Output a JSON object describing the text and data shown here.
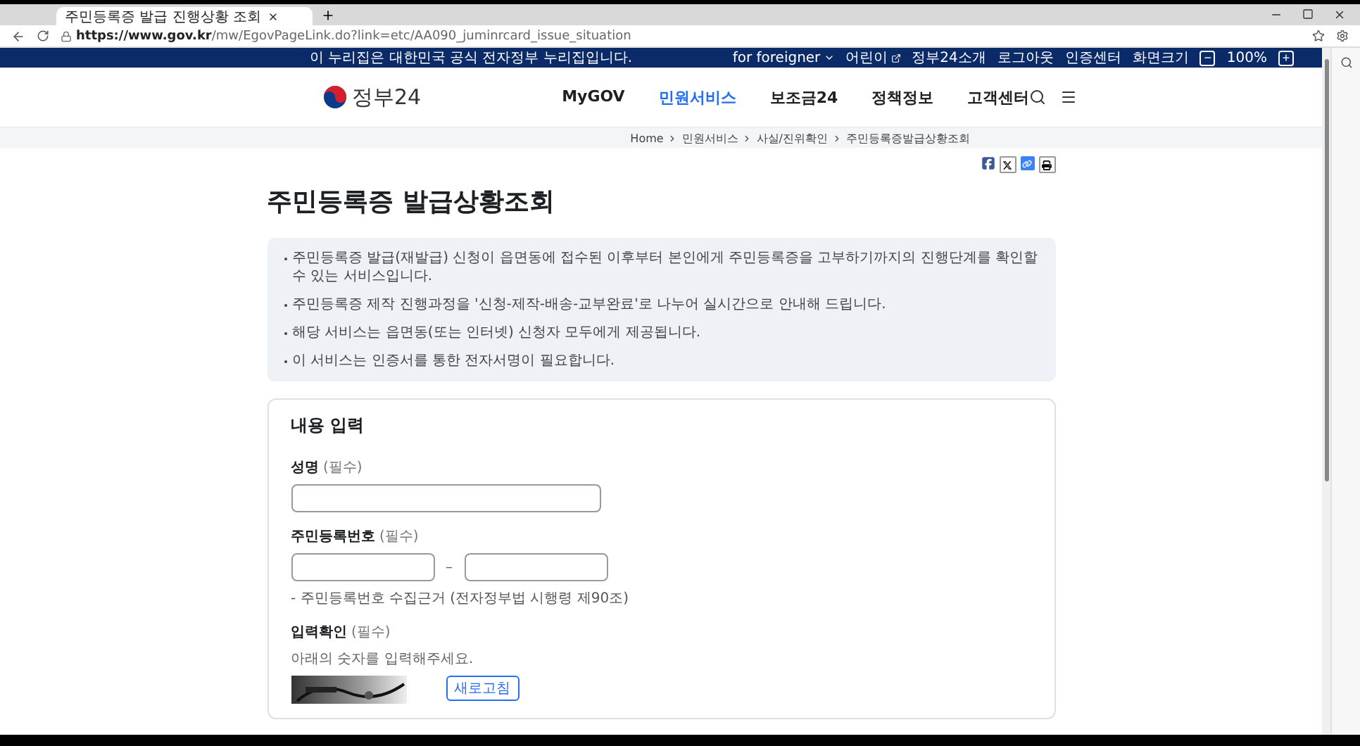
{
  "browser": {
    "tab_title": "주민등록증 발급 진행상황 조회",
    "url_host": "https://www.gov.kr",
    "url_path": "/mw/EgovPageLink.do?link=etc/AA090_juminrcard_issue_situation"
  },
  "gov_banner": {
    "text": "이 누리집은 대한민국 공식 전자정부 누리집입니다."
  },
  "utility_links": [
    {
      "label": "for foreigner",
      "kind": "dropdown"
    },
    {
      "label": "어린이",
      "kind": "external"
    },
    {
      "label": "정부24소개",
      "kind": "link"
    },
    {
      "label": "로그아웃",
      "kind": "link"
    },
    {
      "label": "인증센터",
      "kind": "link"
    }
  ],
  "zoom": {
    "label": "화면크기",
    "minus": "−",
    "value": "100%",
    "plus": "+"
  },
  "header": {
    "logo": "정부24",
    "nav": [
      {
        "label": "MyGOV",
        "selected": false
      },
      {
        "label": "민원서비스",
        "selected": true
      },
      {
        "label": "보조금24",
        "selected": false
      },
      {
        "label": "정책정보",
        "selected": false
      },
      {
        "label": "고객센터",
        "selected": false
      }
    ]
  },
  "breadcrumb": [
    "Home",
    "민원서비스",
    "사실/진위확인",
    "주민등록증발급상황조회"
  ],
  "page_title": "주민등록증 발급상황조회",
  "notices": [
    "주민등록증 발급(재발급) 신청이 읍면동에 접수된 이후부터 본인에게 주민등록증을 고부하기까지의 진행단계를 확인할 수 있는 서비스입니다.",
    "주민등록증 제작 진행과정을 '신청-제작-배송-교부완료'로 나누어 실시간으로 안내해 드립니다.",
    "해당 서비스는 읍면동(또는 인터넷) 신청자 모두에게 제공됩니다.",
    "이 서비스는 인증서를 통한 전자서명이 필요합니다."
  ],
  "form": {
    "heading": "내용 입력",
    "fields": [
      {
        "kind": "text",
        "label": "성명",
        "required": "(필수)"
      },
      {
        "kind": "rrn",
        "label": "주민등록번호",
        "required": "(필수)",
        "separator": "–",
        "note": "- 주민등록번호 수집근거 (전자정부법 시행령 제90조)"
      },
      {
        "kind": "captcha",
        "label": "입력확인",
        "required": "(필수)",
        "hint": "아래의 숫자를 입력해주세요.",
        "button": "새로고침"
      }
    ]
  }
}
